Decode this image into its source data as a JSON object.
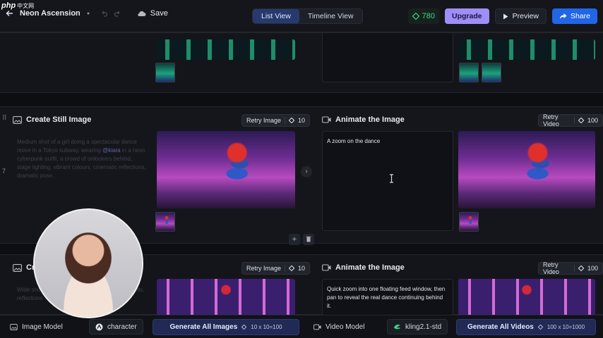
{
  "watermark": {
    "brand": "php",
    "subtitle": "中文网"
  },
  "topbar": {
    "project_title": "Neon Ascension",
    "save_label": "Save",
    "views": [
      {
        "label": "List View",
        "active": true
      },
      {
        "label": "Timeline View",
        "active": false
      }
    ],
    "credits": "780",
    "upgrade_label": "Upgrade",
    "preview_label": "Preview",
    "share_label": "Share"
  },
  "scenes": [
    {
      "number": "7",
      "still": {
        "title": "Create Still Image",
        "retry_label": "Retry Image",
        "retry_cost": "10",
        "prompt_parts": [
          "Medium shot of a girl doing a spectacular dance move in a Tokyo subway, wearing ",
          "@kiara",
          " in a neon cyberpunk outfit, a crowd of onlookers behind, stage lighting, vibrant colours, cinematic reflections, dramatic pose."
        ]
      },
      "animate": {
        "title": "Animate the Image",
        "retry_label": "Retry Video",
        "retry_cost": "100",
        "prompt": "A zoom on the dance"
      }
    },
    {
      "still": {
        "title": "Cre",
        "retry_label": "Retry Image",
        "retry_cost": "10",
        "prompt_parts": [
          "Wide shot of",
          "",
          " the subway carriage, neon pink lights, reflections"
        ]
      },
      "animate": {
        "title": "Animate the Image",
        "retry_label": "Retry Video",
        "retry_cost": "100",
        "prompt": "Quick zoom into one floating feed window, then pan to reveal the real dance continuing behind it."
      }
    }
  ],
  "bottombar": {
    "image_model_label": "Image Model",
    "image_model_value": "character",
    "generate_images_label": "Generate All Images",
    "generate_images_cost": "10 x 10=100",
    "video_model_label": "Video Model",
    "video_model_value": "kling2.1-std",
    "generate_videos_label": "Generate All Videos",
    "generate_videos_cost": "100 x 10=1000"
  },
  "colors": {
    "accent": "#2166e6",
    "upgrade": "#9f8ef7",
    "credits": "#3bd48c",
    "background": "#0d0e12"
  }
}
